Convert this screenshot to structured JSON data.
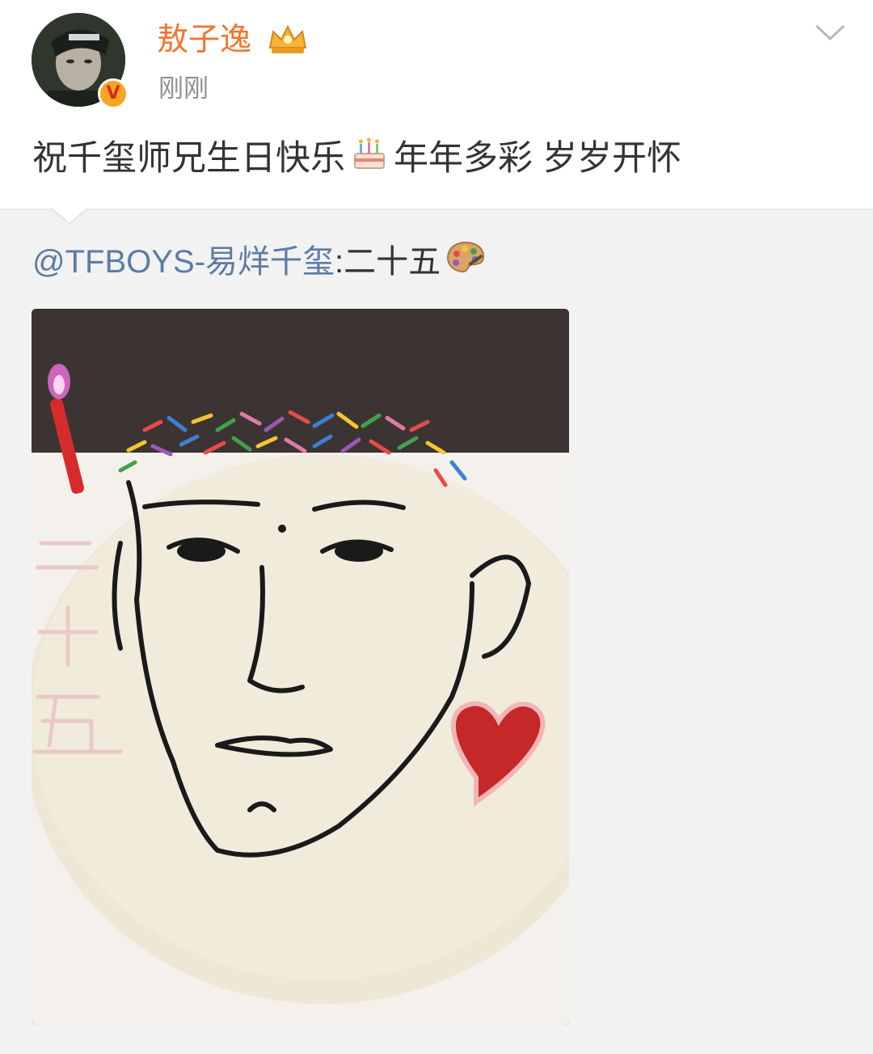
{
  "post": {
    "author_name": "敖子逸",
    "time": "刚刚",
    "verified_badge": "V",
    "text_before": "祝千玺师兄生日快乐",
    "text_after": "年年多彩 岁岁开怀",
    "inline_emoji": "birthday-cake-icon"
  },
  "repost": {
    "mention": "@TFBOYS-易烊千玺",
    "text": ":二十五",
    "inline_emoji": "artist-palette-icon",
    "image_description_label": "cake-photo"
  },
  "colors": {
    "author_name": "#f3742d",
    "mention": "#5b7ca5",
    "repost_bg": "#f2f2f2",
    "time": "#8f8f8f"
  }
}
